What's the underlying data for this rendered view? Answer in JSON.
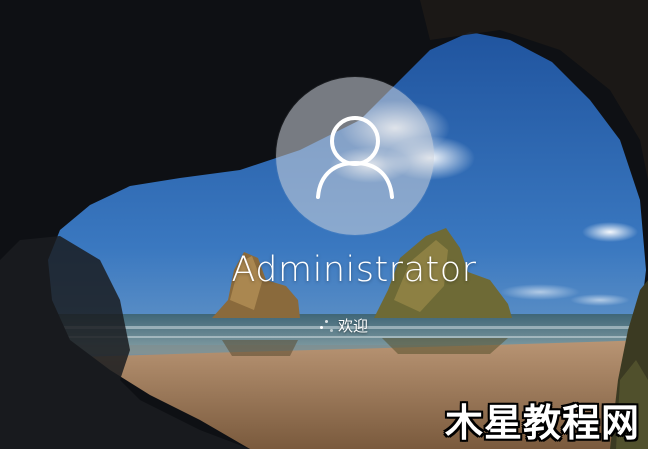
{
  "lockscreen": {
    "username": "Administrator",
    "status_text": "欢迎",
    "avatar_icon": "user-icon",
    "status_icon": "loading-spinner-icon"
  },
  "watermark": {
    "text": "木星教程网"
  },
  "colors": {
    "sky": "#2f63a8",
    "sea": "#5c7a8a",
    "sand": "#a07a55",
    "cave": "#0d0f12",
    "text": "#ffffff"
  }
}
